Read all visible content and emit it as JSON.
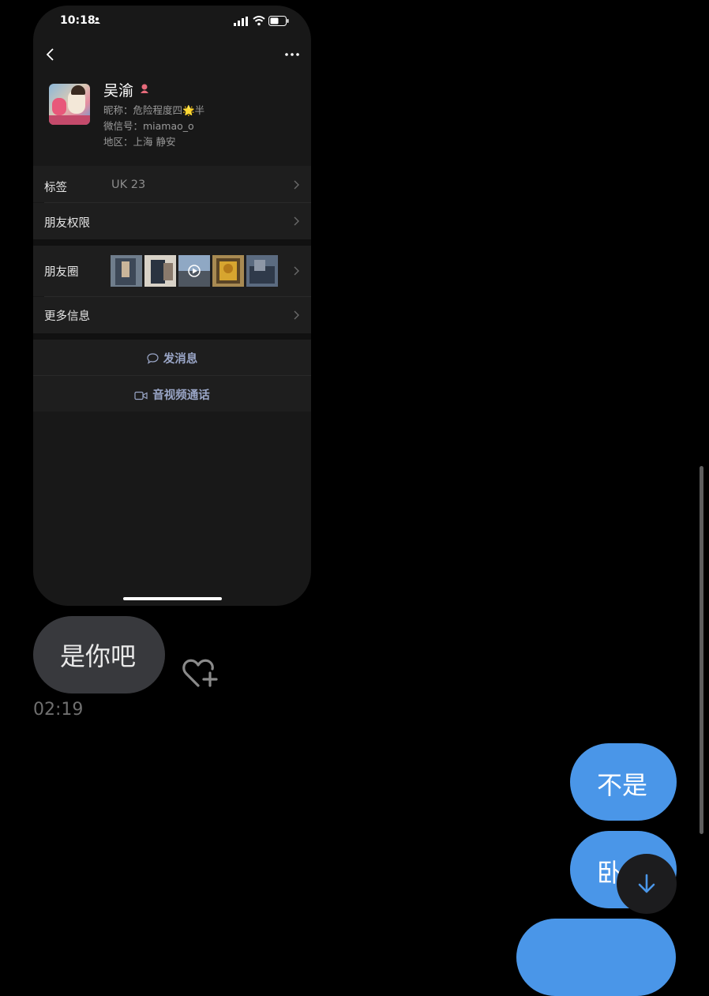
{
  "status_bar": {
    "time": "10:18"
  },
  "profile": {
    "name": "吴渝",
    "nickname": "昵称：危险程度四🌟半",
    "wechat_id": "微信号：miamao_o",
    "region": "地区：上海 静安"
  },
  "cells": {
    "tags_label": "标签",
    "tags_value": "UK 23",
    "permissions_label": "朋友权限",
    "moments_label": "朋友圈",
    "more_info_label": "更多信息"
  },
  "actions": {
    "send_message": "发消息",
    "video_call": "音视频通话"
  },
  "chat": {
    "incoming": [
      {
        "text": "是你吧",
        "time": "02:19"
      }
    ],
    "outgoing": [
      {
        "text": "不是"
      },
      {
        "text": "卧"
      }
    ]
  },
  "colors": {
    "outgoing_bubble": "#4a96e8",
    "incoming_bubble": "#38393d",
    "background": "#000000"
  },
  "icons": [
    "person-icon",
    "signal-icon",
    "wifi-icon",
    "battery-icon",
    "back-icon",
    "more-icon",
    "female-icon",
    "chevron-right-icon",
    "chat-bubble-icon",
    "video-icon",
    "heart-add-icon",
    "arrow-down-icon"
  ]
}
